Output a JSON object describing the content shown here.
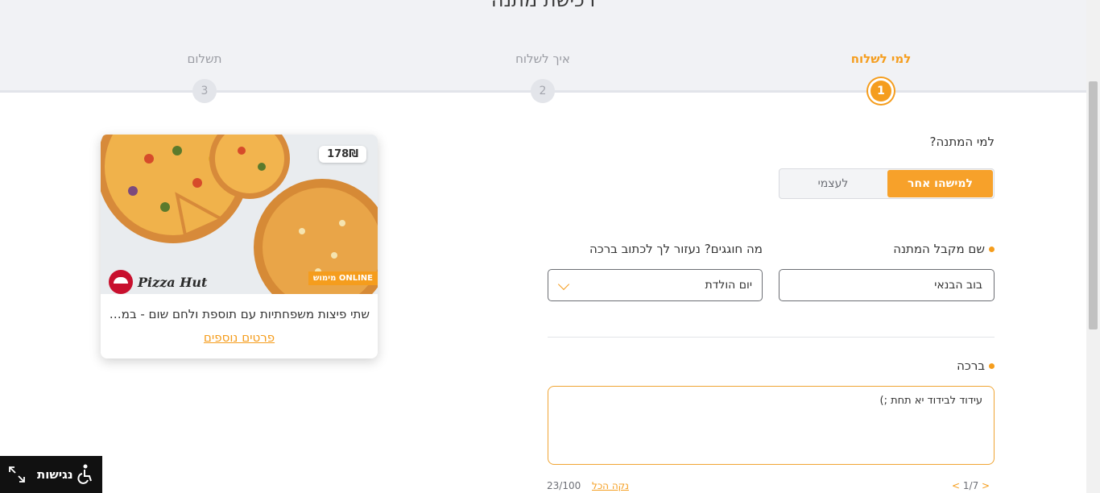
{
  "header": {
    "title": "רכישת מתנה",
    "steps": [
      {
        "label": "למי לשלוח",
        "number": "1",
        "active": true
      },
      {
        "label": "איך לשלוח",
        "number": "2",
        "active": false
      },
      {
        "label": "תשלום",
        "number": "3",
        "active": false
      }
    ]
  },
  "form": {
    "recipient_question": "למי המתנה?",
    "toggle": {
      "other_label": "למישהו אחר",
      "self_label": "לעצמי",
      "selected": "other"
    },
    "recipient_name_label": "שם מקבל המתנה",
    "recipient_name_value": "בוב הבנאי",
    "occasion_label": "מה חוגגים? נעזור לך לכתוב ברכה",
    "occasion_value": "יום הולדת",
    "blessing_label": "ברכה",
    "blessing_value": "עידוד לבידוד יא תחת ;)",
    "pager_text": "1/7",
    "pager_prev": "<",
    "pager_next": ">",
    "clear_all_label": "נקה הכל",
    "char_counter": "23/100",
    "accent_color": "#f59d1d"
  },
  "card": {
    "price": "178₪",
    "online_badge": "מימוש ONLINE",
    "brand": "Pizza Hut",
    "title": "שתי פיצות משפחתיות עם תוספת ולחם שום - במבצע",
    "more_details_link": "פרטים נוספים"
  },
  "accessibility": {
    "label": "נגישות"
  }
}
